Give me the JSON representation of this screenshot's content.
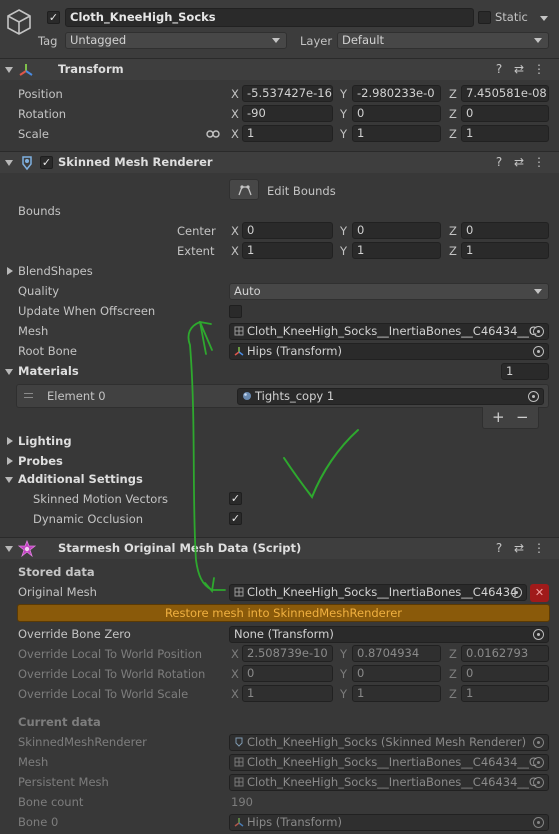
{
  "header": {
    "object_name": "Cloth_KneeHigh_Socks",
    "static_label": "Static",
    "tag_label": "Tag",
    "tag_value": "Untagged",
    "layer_label": "Layer",
    "layer_value": "Default"
  },
  "transform": {
    "title": "Transform",
    "position_label": "Position",
    "rotation_label": "Rotation",
    "scale_label": "Scale",
    "position": {
      "x": "-5.537427e-16",
      "y": "-2.980233e-0",
      "z": "7.450581e-08"
    },
    "rotation": {
      "x": "-90",
      "y": "0",
      "z": "0"
    },
    "scale": {
      "x": "1",
      "y": "1",
      "z": "1"
    }
  },
  "axes": {
    "x": "X",
    "y": "Y",
    "z": "Z"
  },
  "smr": {
    "title": "Skinned Mesh Renderer",
    "edit_bounds": "Edit Bounds",
    "bounds_label": "Bounds",
    "center_label": "Center",
    "extent_label": "Extent",
    "center": {
      "x": "0",
      "y": "0",
      "z": "0"
    },
    "extent": {
      "x": "1",
      "y": "1",
      "z": "1"
    },
    "blendshapes_label": "BlendShapes",
    "quality_label": "Quality",
    "quality_value": "Auto",
    "update_offscreen_label": "Update When Offscreen",
    "mesh_label": "Mesh",
    "mesh_value": "Cloth_KneeHigh_Socks__InertiaBones__C46434__C",
    "root_bone_label": "Root Bone",
    "root_bone_value": "Hips (Transform)",
    "materials_label": "Materials",
    "materials_count": "1",
    "element0_label": "Element 0",
    "element0_value": "Tights_copy 1",
    "plus": "+",
    "minus": "−",
    "lighting_label": "Lighting",
    "probes_label": "Probes",
    "additional_label": "Additional Settings",
    "skinned_motion_label": "Skinned Motion Vectors",
    "dynamic_occlusion_label": "Dynamic Occlusion"
  },
  "starmesh": {
    "title": "Starmesh Original Mesh Data (Script)",
    "stored_data_label": "Stored data",
    "original_mesh_label": "Original Mesh",
    "original_mesh_value": "Cloth_KneeHigh_Socks__InertiaBones__C46434",
    "restore_button": "Restore mesh into SkinnedMeshRenderer",
    "override_bone_zero_label": "Override Bone Zero",
    "override_bone_zero_value": "None (Transform)",
    "oltw_pos_label": "Override Local To World Position",
    "oltw_pos": {
      "x": "2.508739e-10",
      "y": "0.8704934",
      "z": "0.0162793"
    },
    "oltw_rot_label": "Override Local To World Rotation",
    "oltw_rot": {
      "x": "0",
      "y": "0",
      "z": "0"
    },
    "oltw_scale_label": "Override Local To World Scale",
    "oltw_scale": {
      "x": "1",
      "y": "1",
      "z": "1"
    },
    "current_data_label": "Current data",
    "smr_label": "SkinnedMeshRenderer",
    "smr_value": "Cloth_KneeHigh_Socks (Skinned Mesh Renderer)",
    "mesh_label": "Mesh",
    "mesh_value": "Cloth_KneeHigh_Socks__InertiaBones__C46434__C",
    "persistent_mesh_label": "Persistent Mesh",
    "persistent_mesh_value": "Cloth_KneeHigh_Socks__InertiaBones__C46434__C",
    "bone_count_label": "Bone count",
    "bone_count_value": "190",
    "bone0_label": "Bone 0",
    "bone0_value": "Hips (Transform)"
  },
  "colors": {
    "background": "#383838",
    "header": "#3e3e3e",
    "field": "#2a2a2a",
    "restore_button": "#8a5a0a",
    "restore_text": "#f0b040",
    "danger_button": "#a01a1a",
    "annotation": "#2ea82e"
  }
}
